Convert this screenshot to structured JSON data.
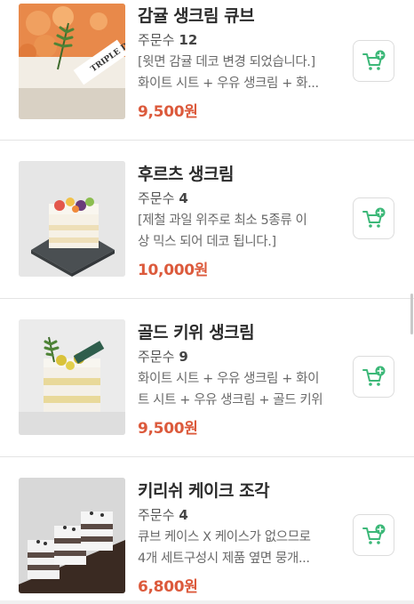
{
  "orders_label": "주문수",
  "accent_color": "#dc5a3c",
  "cart_icon_color": "#3cb878",
  "products": [
    {
      "name": "감귤 생크림 큐브",
      "orders": "12",
      "desc_lines": [
        "[윗면 감귤 데코 변경 되었습니다.]",
        "화이트 시트 + 우유 생크림 + 화..."
      ],
      "price": "9,500원",
      "image_label": "TRIPLE D",
      "image": "cake-tangerine"
    },
    {
      "name": "후르츠 생크림",
      "orders": "4",
      "desc_lines": [
        "[제철 과일 위주로 최소 5종류 이",
        "상 믹스 되어 데코 됩니다.]"
      ],
      "price": "10,000원",
      "image": "cake-fruit"
    },
    {
      "name": "골드 키위 생크림",
      "orders": "9",
      "desc_lines": [
        "화이트 시트 + 우유 생크림 + 화이",
        "트 시트 + 우유 생크림 + 골드 키위"
      ],
      "price": "9,500원",
      "image": "cake-kiwi"
    },
    {
      "name": "키리쉬 케이크 조각",
      "orders": "4",
      "desc_lines": [
        "큐브 케이스 X 케이스가 없으므로",
        "4개 세트구성시 제품 옆면 뭉개..."
      ],
      "price": "6,800원",
      "image": "cake-cookie"
    }
  ]
}
